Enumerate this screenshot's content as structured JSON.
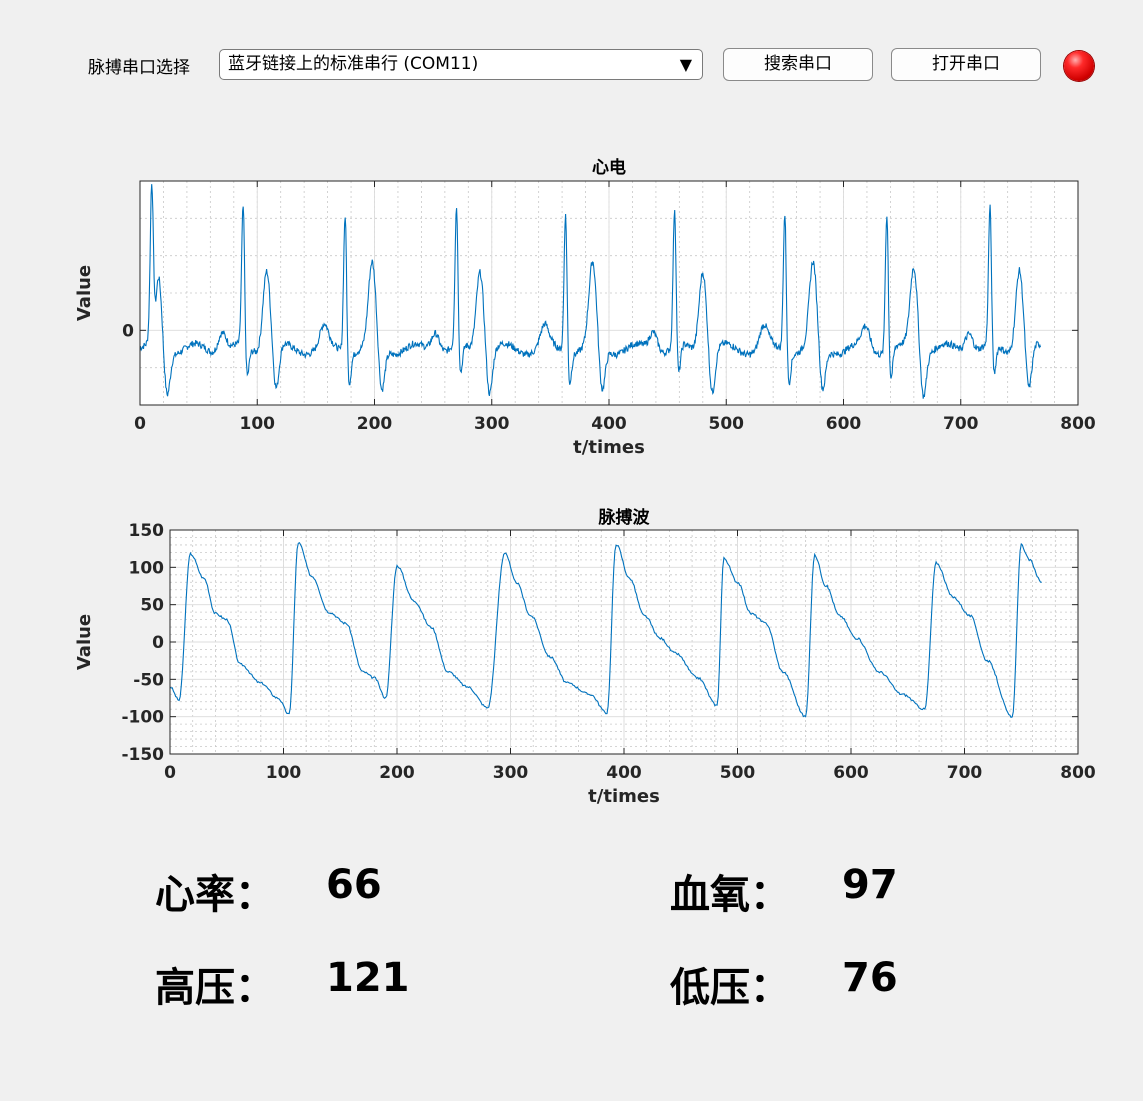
{
  "port": {
    "label": "脉搏串口选择",
    "selected": "蓝牙链接上的标准串行 (COM11)",
    "search_button": "搜索串口",
    "open_button": "打开串口",
    "status_color": "#e00000"
  },
  "chart_data": [
    {
      "type": "line",
      "title": "心电",
      "xlabel": "t/times",
      "ylabel": "Value",
      "xlim": [
        0,
        800
      ],
      "xticks": [
        0,
        100,
        200,
        300,
        400,
        500,
        600,
        700,
        800
      ],
      "yticks": [
        0
      ],
      "ylim": [
        -2,
        4
      ],
      "grid": true,
      "color": "#0072bd",
      "beats": [
        10,
        88,
        175,
        270,
        363,
        456,
        550,
        637,
        725
      ],
      "t_waves": [
        15,
        108,
        198,
        290,
        386,
        480,
        574,
        660,
        750
      ],
      "x_end": 768
    },
    {
      "type": "line",
      "title": "脉搏波",
      "xlabel": "t/times",
      "ylabel": "Value",
      "xlim": [
        0,
        800
      ],
      "ylim": [
        -150,
        150
      ],
      "xticks": [
        0,
        100,
        200,
        300,
        400,
        500,
        600,
        700,
        800
      ],
      "yticks": [
        -150,
        -100,
        -50,
        0,
        50,
        100,
        150
      ],
      "grid": true,
      "color": "#0072bd",
      "series": [
        {
          "x": [
            0,
            8,
            18,
            30,
            40,
            50,
            62,
            80,
            95,
            105,
            113,
            125,
            140,
            155,
            170,
            180,
            190,
            200,
            215,
            230,
            245,
            262,
            280,
            295,
            305,
            318,
            335,
            350,
            370,
            385,
            393,
            405,
            418,
            432,
            445,
            465,
            482,
            488,
            500,
            512,
            525,
            540,
            560,
            568,
            578,
            590,
            605,
            625,
            645,
            665,
            675,
            690,
            705,
            720,
            742,
            750,
            757,
            768
          ],
          "y": [
            -60,
            -78,
            118,
            85,
            38,
            30,
            -30,
            -55,
            -75,
            -97,
            133,
            88,
            40,
            25,
            -40,
            -48,
            -75,
            102,
            55,
            20,
            -40,
            -60,
            -88,
            120,
            80,
            35,
            -20,
            -55,
            -70,
            -95,
            131,
            85,
            35,
            5,
            -15,
            -48,
            -85,
            112,
            80,
            38,
            25,
            -40,
            -100,
            116,
            75,
            35,
            5,
            -40,
            -70,
            -90,
            106,
            60,
            35,
            -25,
            -101,
            130,
            110,
            80
          ]
        }
      ]
    }
  ],
  "stats": {
    "heart_rate_label": "心率：",
    "heart_rate_value": "66",
    "spo2_label": "血氧：",
    "spo2_value": "97",
    "systolic_label": "高压：",
    "systolic_value": "121",
    "diastolic_label": "低压：",
    "diastolic_value": "76"
  }
}
